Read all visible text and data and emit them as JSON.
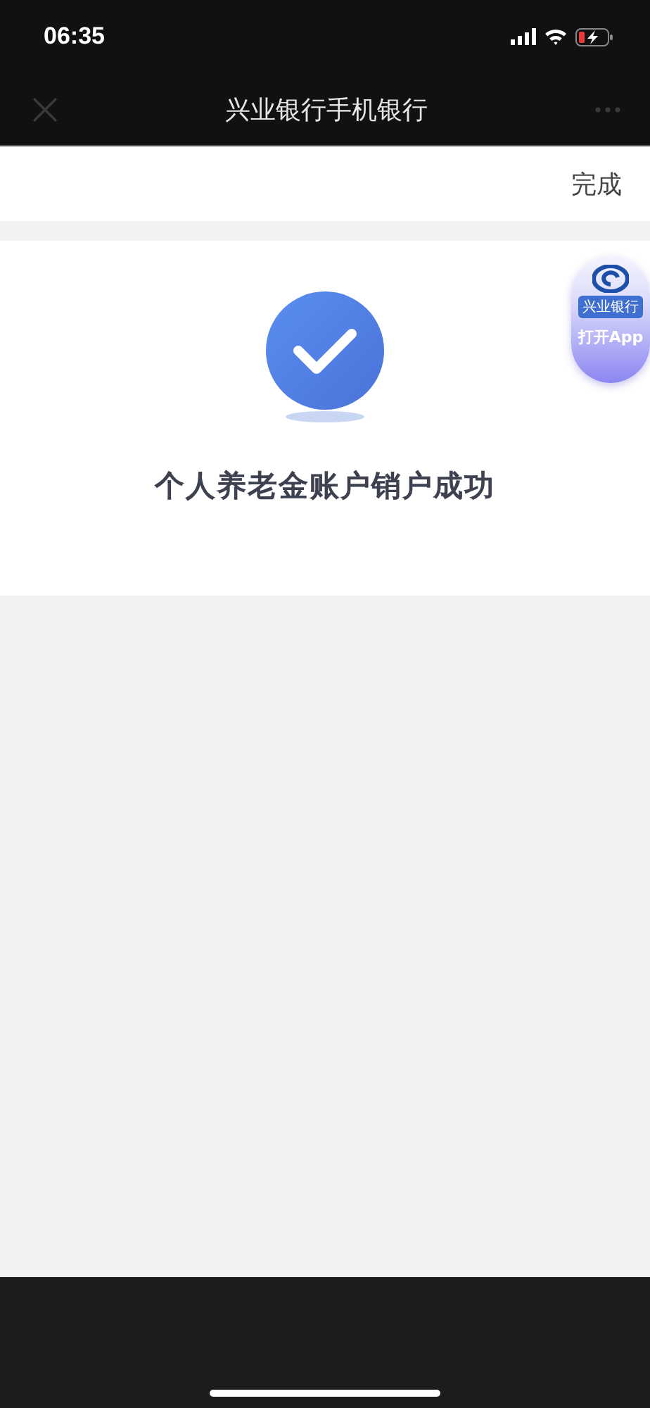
{
  "status_bar": {
    "time": "06:35"
  },
  "nav_bar": {
    "title": "兴业银行手机银行"
  },
  "action_bar": {
    "done_label": "完成"
  },
  "result": {
    "message": "个人养老金账户销户成功"
  },
  "floating_badge": {
    "bank_label": "兴业银行",
    "open_label": "打开App"
  }
}
